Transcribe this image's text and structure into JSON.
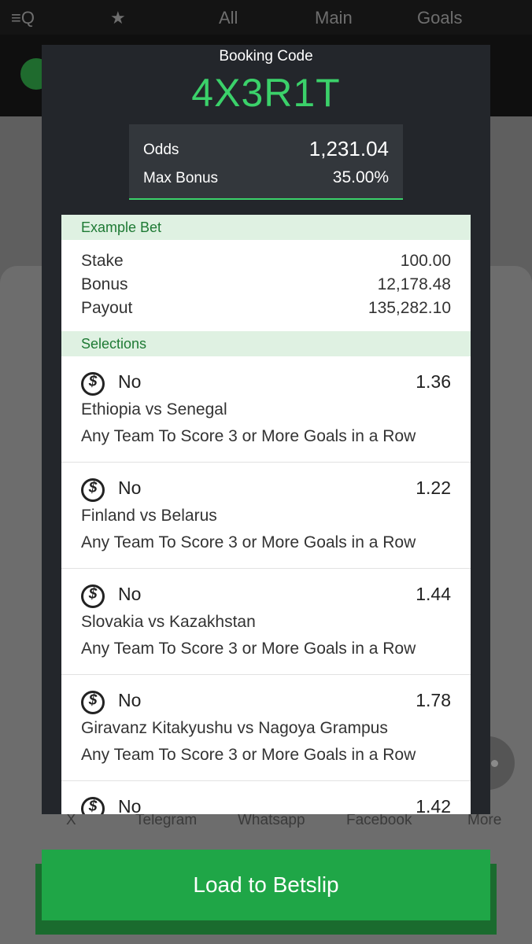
{
  "background": {
    "tabs": [
      "All",
      "Main",
      "Goals"
    ],
    "share": [
      "X",
      "Telegram",
      "Whatsapp",
      "Facebook",
      "More"
    ]
  },
  "modal": {
    "booking_label": "Booking Code",
    "booking_code": "4X3R1T",
    "odds_label": "Odds",
    "odds_value": "1,231.04",
    "max_bonus_label": "Max Bonus",
    "max_bonus_value": "35.00%"
  },
  "example_bet": {
    "header": "Example Bet",
    "rows": [
      {
        "label": "Stake",
        "value": "100.00"
      },
      {
        "label": "Bonus",
        "value": "12,178.48"
      },
      {
        "label": "Payout",
        "value": "135,282.10"
      }
    ]
  },
  "selections": {
    "header": "Selections",
    "items": [
      {
        "pick": "No",
        "odds": "1.36",
        "match": "Ethiopia vs Senegal",
        "market": "Any Team To Score 3 or More Goals in a Row"
      },
      {
        "pick": "No",
        "odds": "1.22",
        "match": "Finland vs Belarus",
        "market": "Any Team To Score 3 or More Goals in a Row"
      },
      {
        "pick": "No",
        "odds": "1.44",
        "match": "Slovakia vs Kazakhstan",
        "market": "Any Team To Score 3 or More Goals in a Row"
      },
      {
        "pick": "No",
        "odds": "1.78",
        "match": "Giravanz Kitakyushu vs Nagoya Grampus",
        "market": "Any Team To Score 3 or More Goals in a Row"
      },
      {
        "pick": "No",
        "odds": "1.42",
        "match": "",
        "market": ""
      }
    ]
  },
  "load_button": "Load to Betslip",
  "colors": {
    "accent_green": "#3bd16a",
    "button_green": "#1fa647",
    "modal_bg": "#23262b"
  }
}
